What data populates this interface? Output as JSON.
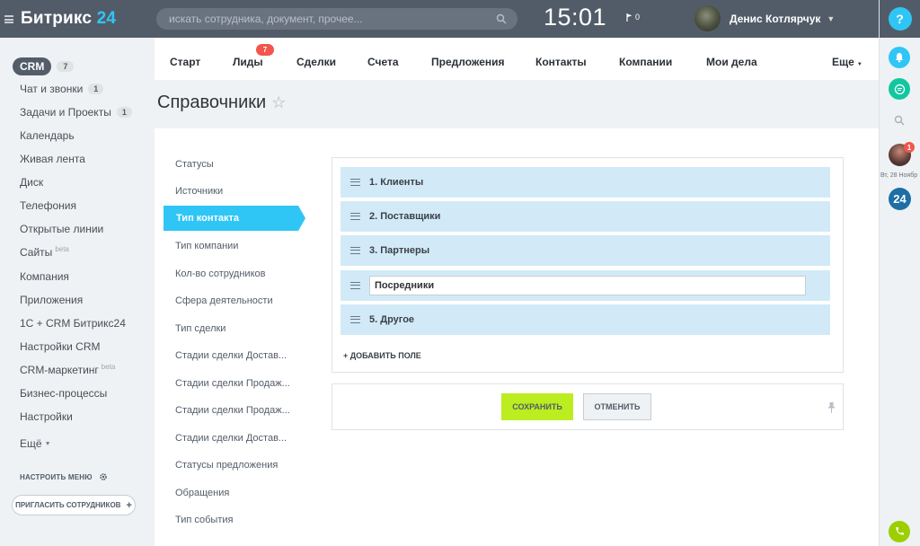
{
  "header": {
    "logo_text": "Битрикс",
    "logo_num": "24",
    "search_placeholder": "искать сотрудника, документ, прочее...",
    "clock": "15:01",
    "flag_count": "0",
    "user_name": "Денис Котлярчук"
  },
  "right_panel": {
    "help": "?",
    "date": "Вт, 28 Ноябр",
    "avatar_badge": "1",
    "b24": "24"
  },
  "left_menu": {
    "crm": {
      "label": "CRM",
      "count": "7"
    },
    "items": [
      {
        "label": "Чат и звонки",
        "count": "1"
      },
      {
        "label": "Задачи и Проекты",
        "count": "1"
      },
      {
        "label": "Календарь"
      },
      {
        "label": "Живая лента"
      },
      {
        "label": "Диск"
      },
      {
        "label": "Телефония"
      },
      {
        "label": "Открытые линии"
      },
      {
        "label": "Сайты",
        "beta": "beta"
      },
      {
        "label": "Компания"
      },
      {
        "label": "Приложения"
      },
      {
        "label": "1С + CRM Битрикс24"
      },
      {
        "label": "Настройки CRM"
      },
      {
        "label": "CRM-маркетинг",
        "beta": "beta"
      },
      {
        "label": "Бизнес-процессы"
      },
      {
        "label": "Настройки"
      },
      {
        "label": "Ещё"
      }
    ],
    "configure": "НАСТРОИТЬ МЕНЮ",
    "invite": "ПРИГЛАСИТЬ СОТРУДНИКОВ"
  },
  "tabs": {
    "items": [
      "Старт",
      "Лиды",
      "Сделки",
      "Счета",
      "Предложения",
      "Контакты",
      "Компании",
      "Мои дела",
      "Еще"
    ],
    "leads_badge": "7"
  },
  "page_title": "Справочники",
  "nav": {
    "items": [
      "Статусы",
      "Источники",
      "Тип контакта",
      "Тип компании",
      "Кол-во сотрудников",
      "Сфера деятельности",
      "Тип сделки",
      "Стадии сделки Достав...",
      "Стадии сделки Продаж...",
      "Стадии сделки Продаж...",
      "Стадии сделки Достав...",
      "Статусы предложения",
      "Обращения",
      "Тип события"
    ],
    "active": "Тип контакта"
  },
  "list": {
    "rows": [
      "1. Клиенты",
      "2. Поставщики",
      "3. Партнеры"
    ],
    "edit_value": "Посредники",
    "last_row": "5. Другое",
    "add_field": "+ ДОБАВИТЬ ПОЛЕ"
  },
  "actions": {
    "save": "СОХРАНИТЬ",
    "cancel": "ОТМЕНИТЬ"
  },
  "colors": {
    "header_bg": "#525c69",
    "accent": "#2fc6f6",
    "save_green": "#bbed21",
    "row_bg": "#d2eaf7",
    "badge_red": "#f2554a"
  }
}
